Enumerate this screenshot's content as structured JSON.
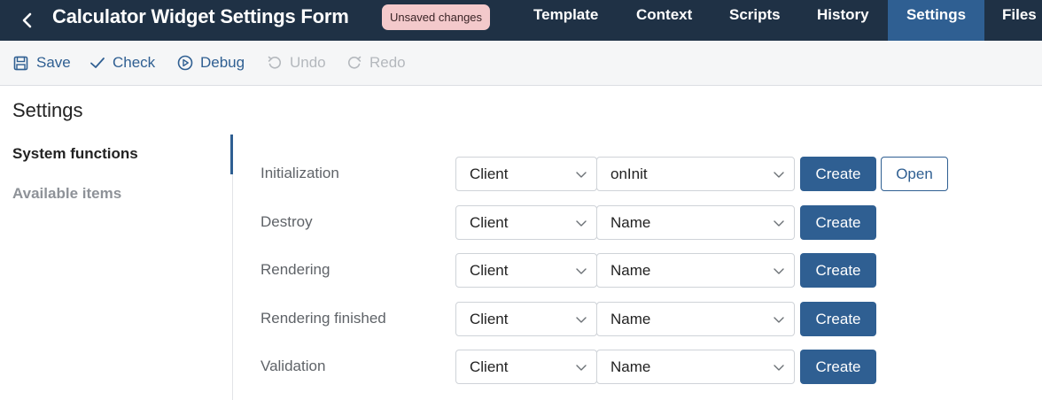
{
  "header": {
    "title": "Calculator Widget Settings Form",
    "badge": "Unsaved changes",
    "tabs": [
      {
        "label": "Template"
      },
      {
        "label": "Context"
      },
      {
        "label": "Scripts"
      },
      {
        "label": "History"
      },
      {
        "label": "Settings",
        "active": true
      },
      {
        "label": "Files"
      }
    ]
  },
  "toolbar": {
    "save": "Save",
    "check": "Check",
    "debug": "Debug",
    "undo": "Undo",
    "redo": "Redo"
  },
  "section": {
    "title": "Settings"
  },
  "nav": {
    "items": [
      {
        "label": "System functions",
        "active": true
      },
      {
        "label": "Available items"
      }
    ]
  },
  "rows": [
    {
      "label": "Initialization",
      "type": "Client",
      "name": "onInit",
      "create": "Create",
      "open": "Open"
    },
    {
      "label": "Destroy",
      "type": "Client",
      "name": "Name",
      "create": "Create"
    },
    {
      "label": "Rendering",
      "type": "Client",
      "name": "Name",
      "create": "Create"
    },
    {
      "label": "Rendering finished",
      "type": "Client",
      "name": "Name",
      "create": "Create"
    },
    {
      "label": "Validation",
      "type": "Client",
      "name": "Name",
      "create": "Create"
    }
  ],
  "colors": {
    "header_bg": "#1f3145",
    "accent": "#2f5f92",
    "badge_bg": "#f3c9cb",
    "toolbar_bg": "#f5f6f7"
  }
}
